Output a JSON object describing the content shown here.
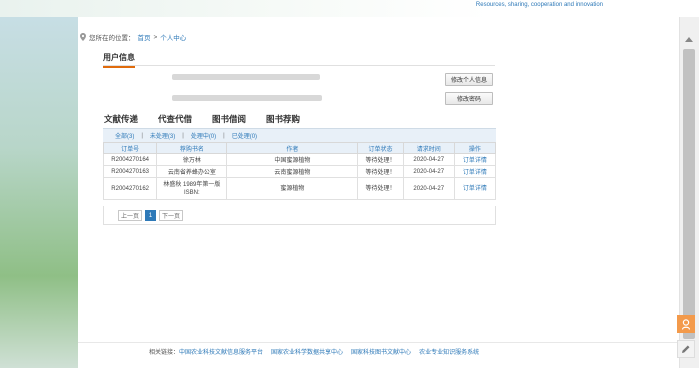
{
  "header": {
    "slogan": "Resources, sharing, cooperation and innovation"
  },
  "breadcrumb": {
    "prefix": "您所在的位置：",
    "home": "首页",
    "sep": " > ",
    "current": "个人中心"
  },
  "user_info": {
    "tab_label": "用户信息",
    "edit_profile_button": "修改个人信息",
    "change_password_button": "修改密码"
  },
  "tabs": [
    "文献传递",
    "代查代借",
    "图书借阅",
    "图书荐购"
  ],
  "filters": [
    "全部(3)",
    "未处理(3)",
    "处理中(0)",
    "已处理(0)"
  ],
  "table": {
    "headers": [
      "订单号",
      "荐购书名",
      "作者",
      "订单状态",
      "请求时间",
      "操作"
    ],
    "rows": [
      {
        "order": "R2004270164",
        "title": "徐万林",
        "author": "中国蜜源植物",
        "status": "等待处理！",
        "time": "2020-04-27",
        "action": "订单详情"
      },
      {
        "order": "R2004270163",
        "title": "云南省养蜂办公室",
        "author": "云南蜜源植物",
        "status": "等待处理！",
        "time": "2020-04-27",
        "action": "订单详情"
      },
      {
        "order": "R2004270162",
        "title": "林盛秋 1989年第一版 ISBN:",
        "author": "蜜源植物",
        "status": "等待处理！",
        "time": "2020-04-27",
        "action": "订单详情"
      }
    ]
  },
  "pager": {
    "prev": "上一页",
    "page": "1",
    "next": "下一页"
  },
  "footer": {
    "label": "相关链接：",
    "links": [
      "中国农业科技文献信息服务平台",
      "国家农业科学数据共享中心",
      "国家科技图书文献中心",
      "农业专业知识服务系统"
    ]
  },
  "colors": {
    "accent": "#2e79b8",
    "tab_underline": "#e06b0c",
    "float_button": "#f39a4b"
  }
}
